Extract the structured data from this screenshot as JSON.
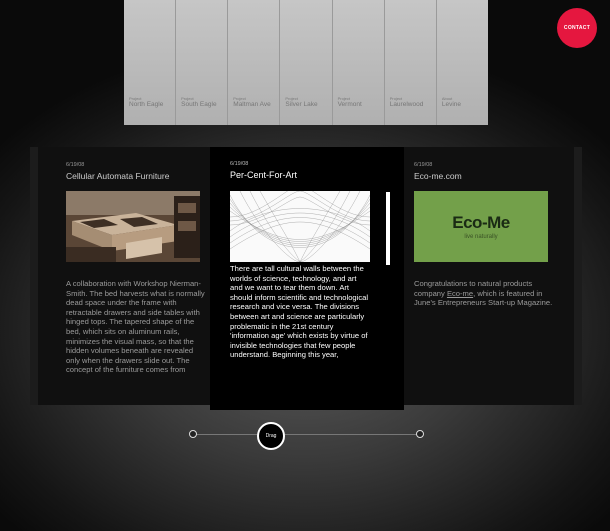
{
  "nav": {
    "projects": [
      {
        "category": "Project",
        "name": "North Eagle"
      },
      {
        "category": "Project",
        "name": "South Eagle"
      },
      {
        "category": "Project",
        "name": "Maltman Ave"
      },
      {
        "category": "Project",
        "name": "Silver Lake"
      },
      {
        "category": "Project",
        "name": "Vermont"
      },
      {
        "category": "Project",
        "name": "Laurelwood"
      },
      {
        "category": "About",
        "name": "Levine"
      }
    ],
    "contact_label": "CONTACT"
  },
  "cards": [
    {
      "date": "6/19/08",
      "title": "Cellular Automata Furniture",
      "body": "A collaboration with Workshop Nierman-Smith. The bed harvests what is normally dead space under the frame with retractable drawers and side tables with hinged tops. The tapered shape of the bed, which sits on aluminum rails, minimizes the visual mass, so that the hidden volumes beneath are revealed only when the drawers slide out. The concept of the furniture comes from"
    },
    {
      "date": "6/19/08",
      "title": "Per-Cent-For-Art",
      "body": "There are tall cultural walls between the worlds of science, technology, and art and we want to tear them down. Art should inform scientific and technological research and vice versa. The divisions between art and science are particularly problematic in the 21st century 'information age' which exists by virtue of invisible technologies that few people understand. Beginning this year,"
    },
    {
      "date": "6/19/08",
      "title": "Eco-me.com",
      "image_logo": "Eco-Me",
      "image_tagline": "live naturally",
      "body_before": "Congratulations to natural products company ",
      "body_link": "Eco-me",
      "body_after": ", which is featured in June's Entrepreneurs Start-up Magazine."
    }
  ],
  "slider": {
    "label": "Drag"
  }
}
